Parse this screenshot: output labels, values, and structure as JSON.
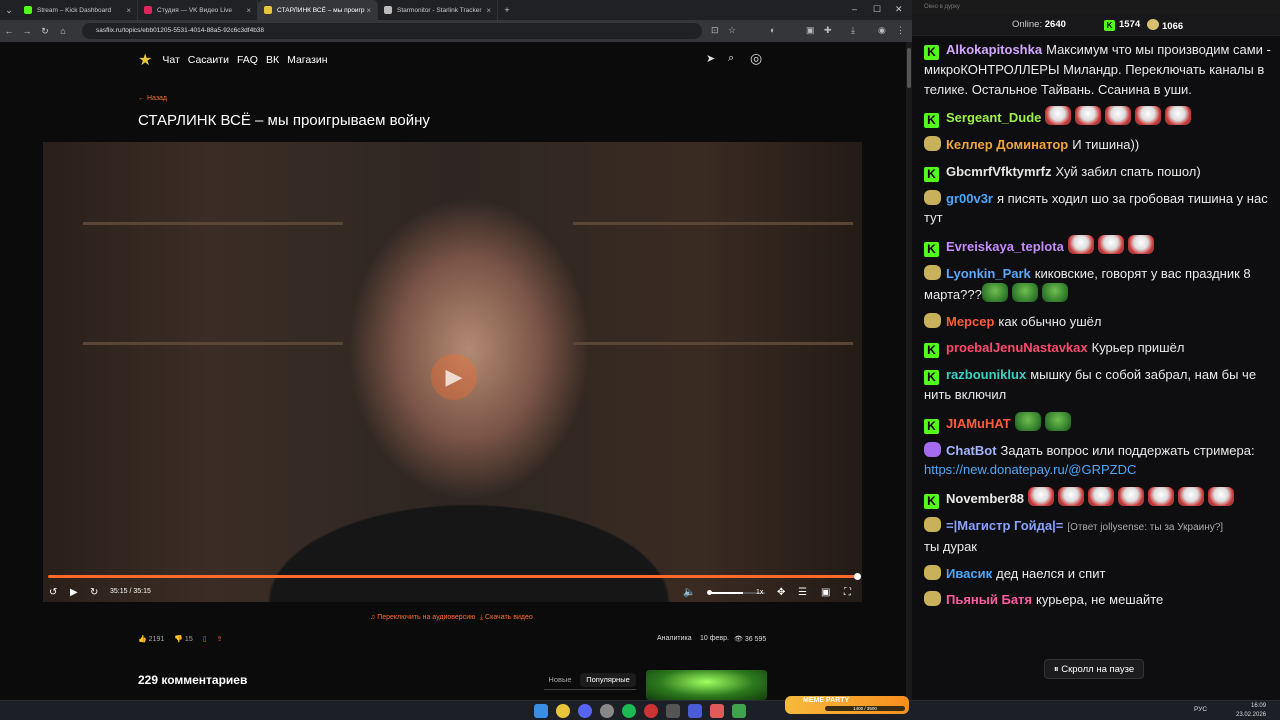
{
  "browser": {
    "tabs": [
      {
        "title": "Stream – Kick Dashboard",
        "color": "#53fc18"
      },
      {
        "title": "Студия — VK Видео Live",
        "color": "#e0245e"
      },
      {
        "title": "СТАРЛИНК ВСЁ – мы проигр",
        "color": "#e8c63b"
      },
      {
        "title": "Starmonitor - Starlink Tracker",
        "color": "#bbbbbb"
      }
    ],
    "url": "sasflix.ru/topics/ebb01205-5531-4014-88a5-92c6c3df4b38"
  },
  "site": {
    "nav": [
      "Чат",
      "Сасаити",
      "FAQ",
      "ВК",
      "Магазин"
    ],
    "back": "← Назад",
    "title": "СТАРЛИНК ВСЁ – мы проигрываем войну"
  },
  "player": {
    "time": "35:15 / 35:15",
    "speed": "1x",
    "progress": 1.0
  },
  "below": {
    "audio": "Переключить на аудиоверсию",
    "download": "Скачать видео",
    "likes": "2191",
    "dislikes": "15",
    "analytics": "Аналитика",
    "date": "10 февр.",
    "views": "36 595",
    "comments": "229 комментариев",
    "sort_new": "Новые",
    "sort_popular": "Популярные"
  },
  "chat": {
    "window_title": "Окно в дурку",
    "online_label": "Online:",
    "online": "2640",
    "kick_count": "1574",
    "vk_count": "1066",
    "paused": "⏸ Скролл на паузе",
    "messages": [
      {
        "user": "Alkokapitoshka",
        "color": "#d2a8ff",
        "text": "Максимум что мы производим сами - микроКОНТРОЛЛЕРЫ Миландр. Переключать каналы в телике. Остальное Тайвань. Ссанина в уши.",
        "src": "kick"
      },
      {
        "user": "Sergeant_Dude",
        "color": "#9ef04a",
        "text": "",
        "src": "kick",
        "emotes": 5
      },
      {
        "user": "Келлер Доминатор",
        "color": "#f0a43a",
        "text": "И тишина))",
        "src": "vk"
      },
      {
        "user": "GbcmrfVfktymrfz",
        "color": "#e6e6e6",
        "text": "Хуй забил спать пошол)",
        "src": "kick"
      },
      {
        "user": "gr00v3r",
        "color": "#4aa8ff",
        "text": "я писять ходил шо за гробовая тишина у нас тут",
        "src": "vk"
      },
      {
        "user": "Evreiskaya_teplota",
        "color": "#c68cff",
        "text": "",
        "src": "kick",
        "emotes": 3
      },
      {
        "user": "Lyonkin_Park",
        "color": "#5aa8ff",
        "text": "киковские, говорят у вас праздник 8 марта???",
        "src": "vk",
        "frogs": 3
      },
      {
        "user": "Мерсер",
        "color": "#ff5a3c",
        "text": "как обычно ушёл",
        "src": "vk"
      },
      {
        "user": "proebalJenuNastavkax",
        "color": "#ff4a6e",
        "text": "Курьер пришёл",
        "src": "kick"
      },
      {
        "user": "razbouniklux",
        "color": "#3ad1c4",
        "text": "мышку бы с собой забрал, нам бы че нить включил",
        "src": "kick"
      },
      {
        "user": "JIAMuHAT",
        "color": "#ff5a3c",
        "text": "",
        "src": "kick",
        "frogs": 2
      },
      {
        "user": "ChatBot",
        "color": "#a6b4ff",
        "text": "Задать вопрос или поддержать стримера: ",
        "link": "https://new.donatepay.ru/@GRPZDC",
        "src": "bot"
      },
      {
        "user": "November88",
        "color": "#eaeaea",
        "text": "",
        "src": "kick",
        "emotes": 7
      },
      {
        "user": "=|Магистр Гойда|=",
        "color": "#8aa0ff",
        "reply": "[Ответ jollysense: ты за Украину?]",
        "text": "ты дурак",
        "src": "vk"
      },
      {
        "user": "Ивасик",
        "color": "#4aa8ff",
        "text": "дед наелся и спит",
        "src": "vk"
      },
      {
        "user": "Пьяный Батя",
        "color": "#ff5aa0",
        "text": "курьера, не мешайте",
        "src": "vk"
      }
    ]
  },
  "party": {
    "label": "MEME PARTY",
    "progress_text": "1400 / 3500"
  },
  "taskbar": {
    "lang": "РУС",
    "time": "16:09",
    "date": "23.02.2026"
  }
}
